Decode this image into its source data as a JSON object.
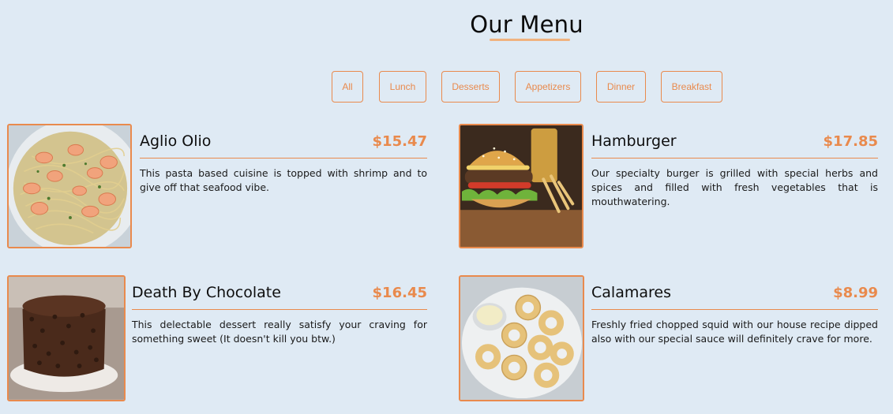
{
  "header": {
    "title": "Our Menu"
  },
  "filters": [
    {
      "label": "All"
    },
    {
      "label": "Lunch"
    },
    {
      "label": "Desserts"
    },
    {
      "label": "Appetizers"
    },
    {
      "label": "Dinner"
    },
    {
      "label": "Breakfast"
    }
  ],
  "menu_items": [
    {
      "name": "Aglio Olio",
      "price": "$15.47",
      "description": "This pasta based cuisine is topped with shrimp and to give off that seafood vibe.",
      "image": "shrimp-pasta"
    },
    {
      "name": "Hamburger",
      "price": "$17.85",
      "description": "Our specialty burger is grilled with special herbs and spices and filled with fresh vegetables that is mouthwatering.",
      "image": "burger"
    },
    {
      "name": "Death By Chocolate",
      "price": "$16.45",
      "description": "This delectable dessert really satisfy your craving for something sweet (It doesn't kill you btw.)",
      "image": "chocolate-cake"
    },
    {
      "name": "Calamares",
      "price": "$8.99",
      "description": "Freshly fried chopped squid with our house recipe dipped also with our special sauce will definitely crave for more.",
      "image": "fried-calamari"
    }
  ],
  "colors": {
    "background": "#dfeaf4",
    "accent": "#e98a4d",
    "underline": "#f0b27f"
  }
}
